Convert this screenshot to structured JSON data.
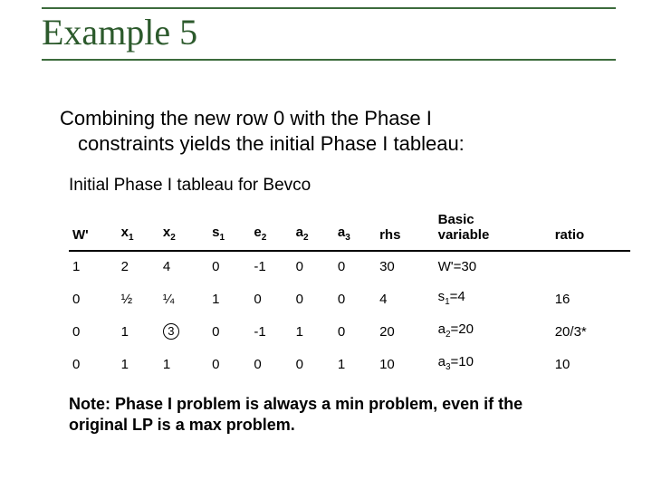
{
  "title": "Example 5",
  "body_line1": "Combining the new row 0 with the Phase I",
  "body_line2": "constraints yields the initial Phase I tableau:",
  "caption": "Initial Phase I tableau for Bevco",
  "headers": {
    "c0": "W'",
    "c1": "x",
    "c1sub": "1",
    "c2": "x",
    "c2sub": "2",
    "c3": "s",
    "c3sub": "1",
    "c4": "e",
    "c4sub": "2",
    "c5": "a",
    "c5sub": "2",
    "c6": "a",
    "c6sub": "3",
    "c7": "rhs",
    "c8a": "Basic",
    "c8b": "variable",
    "c9": "ratio"
  },
  "rows": [
    {
      "c0": "1",
      "c1": "2",
      "c2": "4",
      "c3": "0",
      "c4": "-1",
      "c5": "0",
      "c6": "0",
      "c7": "30",
      "bv": "W'=30",
      "ratio": ""
    },
    {
      "c0": "0",
      "c1": "½",
      "c2": "¼",
      "c3": "1",
      "c4": "0",
      "c5": "0",
      "c6": "0",
      "c7": "4",
      "bv_var": "s",
      "bv_sub": "1",
      "bv_rest": "=4",
      "ratio": "16"
    },
    {
      "c0": "0",
      "c1": "1",
      "c2_circled": "3",
      "c3": "0",
      "c4": "-1",
      "c5": "1",
      "c6": "0",
      "c7": "20",
      "bv_var": "a",
      "bv_sub": "2",
      "bv_rest": "=20",
      "ratio": "20/3*"
    },
    {
      "c0": "0",
      "c1": "1",
      "c2": "1",
      "c3": "0",
      "c4": "0",
      "c5": "0",
      "c6": "1",
      "c7": "10",
      "bv_var": "a",
      "bv_sub": "3",
      "bv_rest": "=10",
      "ratio": "10"
    }
  ],
  "note_line1": "Note: Phase I problem is always a min problem, even if the",
  "note_line2": "original LP is a max problem.",
  "chart_data": {
    "type": "table",
    "title": "Initial Phase I tableau for Bevco",
    "columns": [
      "W'",
      "x1",
      "x2",
      "s1",
      "e2",
      "a2",
      "a3",
      "rhs",
      "Basic variable",
      "ratio"
    ],
    "rows": [
      [
        1,
        2,
        4,
        0,
        -1,
        0,
        0,
        30,
        "W'=30",
        ""
      ],
      [
        0,
        0.5,
        0.25,
        1,
        0,
        0,
        0,
        4,
        "s1=4",
        16
      ],
      [
        0,
        1,
        3,
        0,
        -1,
        1,
        0,
        20,
        "a2=20",
        "20/3*"
      ],
      [
        0,
        1,
        1,
        0,
        0,
        0,
        1,
        10,
        "a3=10",
        10
      ]
    ],
    "pivot": {
      "row_index": 2,
      "col": "x2",
      "value": 3
    }
  }
}
